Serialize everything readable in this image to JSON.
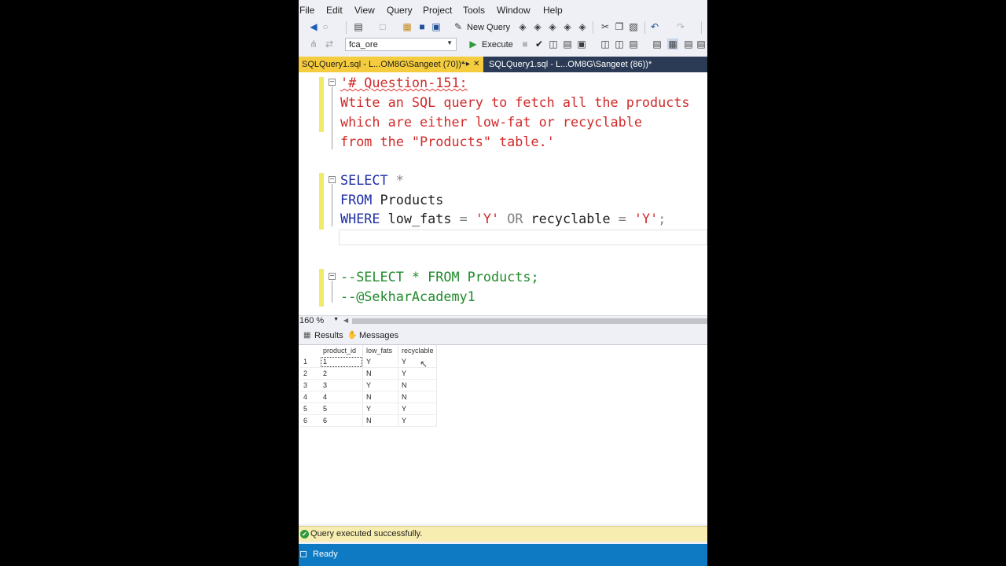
{
  "menu": [
    "File",
    "Edit",
    "View",
    "Query",
    "Project",
    "Tools",
    "Window",
    "Help"
  ],
  "toolbar": {
    "new_query_label": "New Query",
    "database": "fca_ore",
    "execute_label": "Execute"
  },
  "tabs": [
    {
      "label": "SQLQuery1.sql - L...OM8G\\Sangeet (70))*",
      "active": true
    },
    {
      "label": "SQLQuery1.sql - L...OM8G\\Sangeet (86))*",
      "active": false
    }
  ],
  "editor": {
    "comment_block": {
      "line1": "'# Question-151:",
      "line2": "Wtite an SQL query to fetch all the products",
      "line3": "which are either low-fat or recyclable",
      "line4": "from the \"Products\" table.'"
    },
    "query": {
      "select_kw": "SELECT",
      "star": "*",
      "from_kw": "FROM",
      "table": "Products",
      "where_kw": "WHERE",
      "col1": "low_fats",
      "eq1": "=",
      "val1": "'Y'",
      "or_kw": "OR",
      "col2": "recyclable",
      "eq2": "=",
      "val2": "'Y'",
      "semicolon": ";"
    },
    "comments": {
      "line1": "--SELECT * FROM Products;",
      "line2": "--@SekharAcademy1"
    }
  },
  "zoom": "160 %",
  "results_tabs": {
    "results": "Results",
    "messages": "Messages"
  },
  "results": {
    "columns": [
      "product_id",
      "low_fats",
      "recyclable"
    ],
    "rows": [
      {
        "n": "1",
        "product_id": "1",
        "low_fats": "Y",
        "recyclable": "Y"
      },
      {
        "n": "2",
        "product_id": "2",
        "low_fats": "N",
        "recyclable": "Y"
      },
      {
        "n": "3",
        "product_id": "3",
        "low_fats": "Y",
        "recyclable": "N"
      },
      {
        "n": "4",
        "product_id": "4",
        "low_fats": "N",
        "recyclable": "N"
      },
      {
        "n": "5",
        "product_id": "5",
        "low_fats": "Y",
        "recyclable": "Y"
      },
      {
        "n": "6",
        "product_id": "6",
        "low_fats": "N",
        "recyclable": "Y"
      }
    ]
  },
  "status": {
    "query_status": "Query executed successfully.",
    "app_status": "Ready"
  },
  "colors": {
    "tab_active": "#f5cc3e",
    "tabstrip": "#2b3a55",
    "status_bar": "#0e7ac4",
    "query_status_bg": "#f7edb0"
  }
}
